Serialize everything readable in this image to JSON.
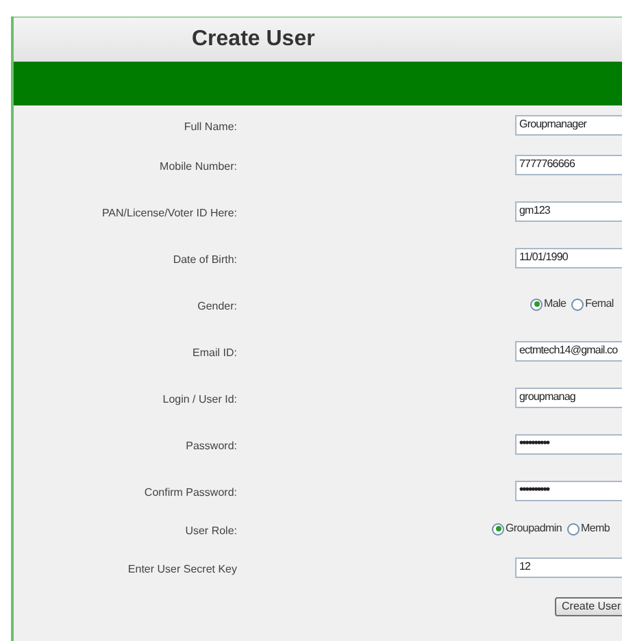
{
  "title": "Create User",
  "fields": [
    {
      "kind": "text",
      "label": "Full Name:",
      "value": "Groupmanager"
    },
    {
      "kind": "text",
      "label": "Mobile Number:",
      "value": "7777766666"
    },
    {
      "kind": "text",
      "label": "PAN/License/Voter ID Here:",
      "value": "gm123"
    },
    {
      "kind": "text",
      "label": "Date of Birth:",
      "value": "11/01/1990"
    },
    {
      "kind": "radio",
      "label": "Gender:",
      "options": [
        {
          "label": "Male",
          "selected": true
        },
        {
          "label": "Femal",
          "selected": false
        }
      ]
    },
    {
      "kind": "text",
      "label": "Email ID:",
      "value": "ectmtech14@gmail.co"
    },
    {
      "kind": "text",
      "label": "Login / User Id:",
      "value": "groupmanag"
    },
    {
      "kind": "password",
      "label": "Password:",
      "value": "••••••••••"
    },
    {
      "kind": "password",
      "label": "Confirm Password:",
      "value": "••••••••••"
    },
    {
      "kind": "radio",
      "label": "User Role:",
      "options": [
        {
          "label": "Groupadmin",
          "selected": true
        },
        {
          "label": "Memb",
          "selected": false
        }
      ]
    },
    {
      "kind": "text",
      "label": "Enter User Secret Key",
      "value": "12"
    }
  ],
  "submit": "Create User"
}
